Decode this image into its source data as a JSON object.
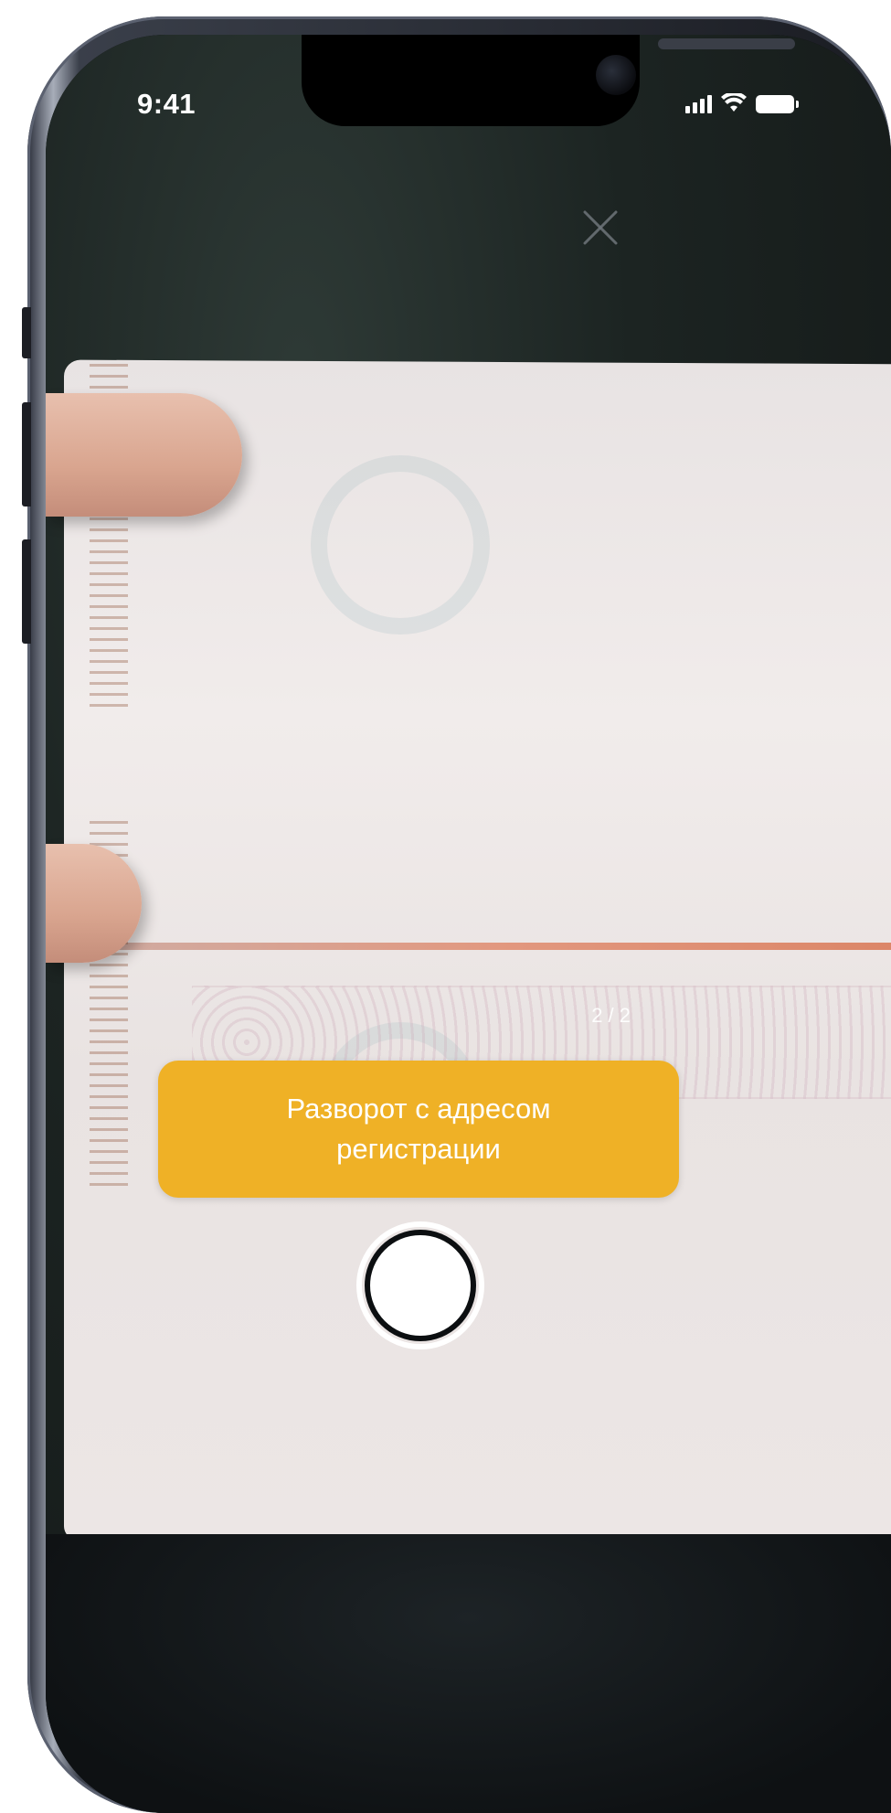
{
  "status_bar": {
    "time": "9:41",
    "icons": [
      "signal-icon",
      "wifi-icon",
      "battery-icon"
    ]
  },
  "camera": {
    "page_counter": "2 / 2",
    "close_icon": "close-icon"
  },
  "hint": {
    "text": "Разворот с адресом регистрации",
    "background": "#efb126",
    "color": "#ffffff"
  },
  "shutter": {
    "icon": "shutter-button"
  }
}
